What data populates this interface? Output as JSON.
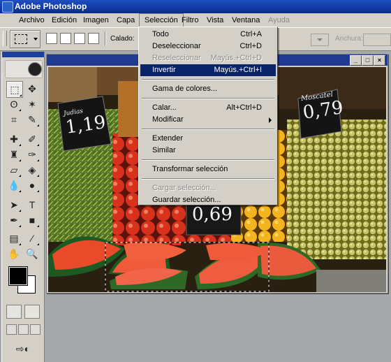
{
  "app": {
    "title": "Adobe Photoshop"
  },
  "menubar": [
    {
      "label": "Archivo",
      "active": false,
      "disabled": false
    },
    {
      "label": "Edición",
      "active": false,
      "disabled": false
    },
    {
      "label": "Imagen",
      "active": false,
      "disabled": false
    },
    {
      "label": "Capa",
      "active": false,
      "disabled": false
    },
    {
      "label": "Selección",
      "active": true,
      "disabled": false
    },
    {
      "label": "Filtro",
      "active": false,
      "disabled": false
    },
    {
      "label": "Vista",
      "active": false,
      "disabled": false
    },
    {
      "label": "Ventana",
      "active": false,
      "disabled": false
    },
    {
      "label": "Ayuda",
      "active": false,
      "disabled": true
    }
  ],
  "options": {
    "feather_label": "Calado:",
    "width_label": "Anchura:"
  },
  "selection_menu": [
    {
      "label": "Todo",
      "shortcut": "Ctrl+A",
      "state": "normal"
    },
    {
      "label": "Deseleccionar",
      "shortcut": "Ctrl+D",
      "state": "normal"
    },
    {
      "label": "Reseleccionar",
      "shortcut": "Mayús.+Ctrl+D",
      "state": "disabled"
    },
    {
      "label": "Invertir",
      "shortcut": "Mayús.+Ctrl+I",
      "state": "highlighted"
    },
    {
      "separator": true
    },
    {
      "label": "Gama de colores...",
      "shortcut": "",
      "state": "normal"
    },
    {
      "separator": true
    },
    {
      "label": "Calar...",
      "shortcut": "Alt+Ctrl+D",
      "state": "normal"
    },
    {
      "label": "Modificar",
      "shortcut": "",
      "state": "normal",
      "submenu": true
    },
    {
      "separator": true
    },
    {
      "label": "Extender",
      "shortcut": "",
      "state": "normal"
    },
    {
      "label": "Similar",
      "shortcut": "",
      "state": "normal"
    },
    {
      "separator": true
    },
    {
      "label": "Transformar selección",
      "shortcut": "",
      "state": "normal"
    },
    {
      "separator": true
    },
    {
      "label": "Cargar selección...",
      "shortcut": "",
      "state": "disabled"
    },
    {
      "label": "Guardar selección...",
      "shortcut": "",
      "state": "normal"
    }
  ],
  "photo": {
    "price_tags": [
      {
        "text": "Judias",
        "price": "1,19"
      },
      {
        "text": "",
        "price": "0,69"
      },
      {
        "text": "Moscatel",
        "price": "0,79"
      }
    ]
  },
  "colors": {
    "title_blue": "#0a2a8f",
    "highlight": "#0a246a",
    "chrome": "#d4d0c8"
  }
}
